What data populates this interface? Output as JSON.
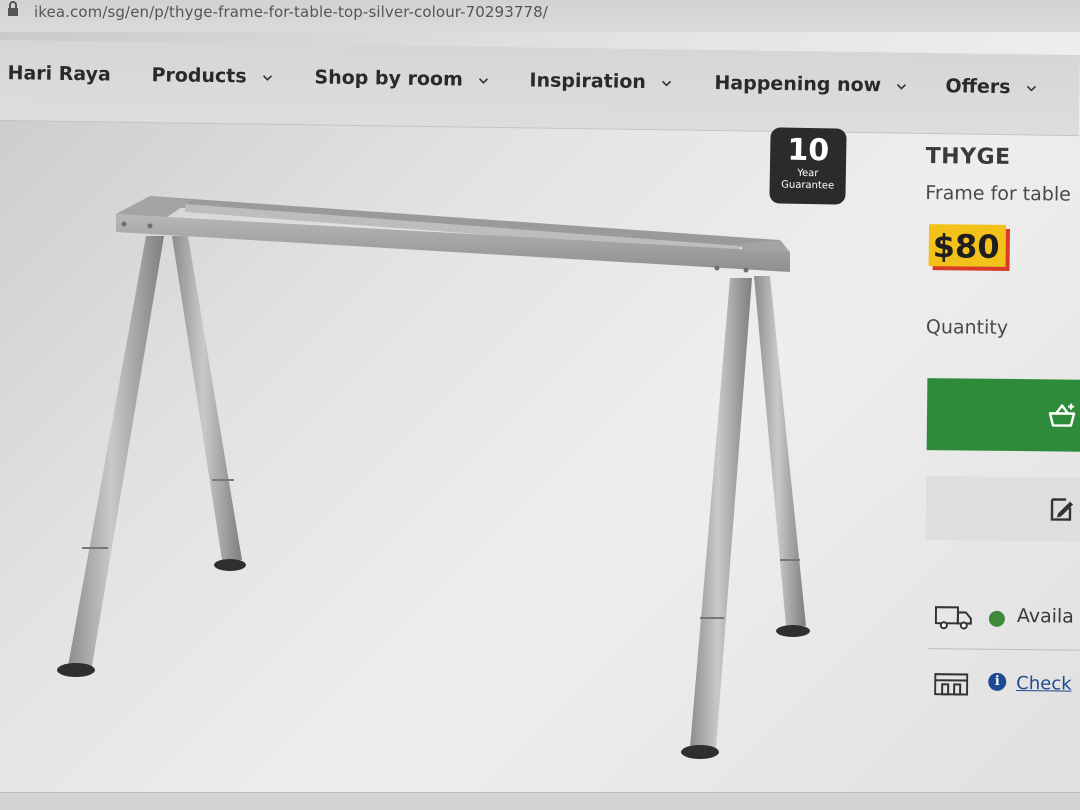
{
  "browser": {
    "url": "ikea.com/sg/en/p/thyge-frame-for-table-top-silver-colour-70293778/"
  },
  "nav": {
    "items": [
      {
        "label": "Hari Raya"
      },
      {
        "label": "Products"
      },
      {
        "label": "Shop by room"
      },
      {
        "label": "Inspiration"
      },
      {
        "label": "Happening now"
      },
      {
        "label": "Offers"
      }
    ]
  },
  "badge": {
    "number": "10",
    "line1": "Year",
    "line2": "Guarantee"
  },
  "product": {
    "name": "THYGE",
    "description": "Frame for table",
    "price": "$80",
    "quantity_label": "Quantity",
    "delivery_text": "Availa",
    "store_link": "Check"
  },
  "colors": {
    "cart_button": "#2e8b3a",
    "price_bg": "#f2c21b",
    "price_shadow": "#d93b2b",
    "status_available": "#3c8a3a",
    "link": "#1e4b8f"
  },
  "icons": {
    "lock": "lock-icon",
    "chevron": "chevron-down-icon",
    "cart": "add-to-cart-icon",
    "edit": "edit-note-icon",
    "truck": "delivery-truck-icon",
    "store": "store-icon",
    "info": "info-icon"
  }
}
